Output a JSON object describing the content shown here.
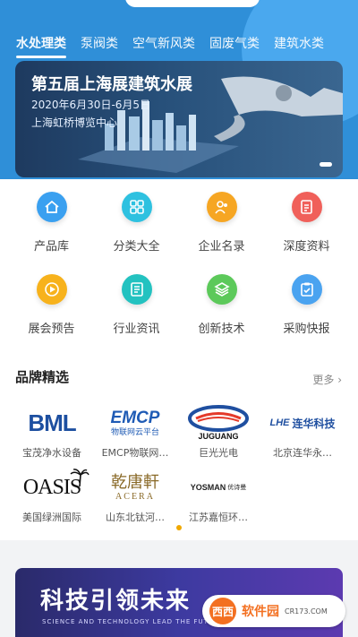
{
  "tabs": [
    "水处理类",
    "泵阀类",
    "空气新风类",
    "固废气类",
    "建筑水类"
  ],
  "active_tab": 0,
  "banner": {
    "title": "第五届上海展建筑水展",
    "date": "2020年6月30日-6月5日",
    "venue": "上海虹桥博览中心"
  },
  "grid": [
    {
      "label": "产品库",
      "icon": "home-icon",
      "color": "#3aa0f0"
    },
    {
      "label": "分类大全",
      "icon": "category-icon",
      "color": "#2ec1e0"
    },
    {
      "label": "企业名录",
      "icon": "people-icon",
      "color": "#f6a623"
    },
    {
      "label": "深度资料",
      "icon": "document-icon",
      "color": "#f0605a"
    },
    {
      "label": "展会预告",
      "icon": "play-icon",
      "color": "#f7b21c"
    },
    {
      "label": "行业资讯",
      "icon": "news-icon",
      "color": "#23c2c0"
    },
    {
      "label": "创新技术",
      "icon": "layers-icon",
      "color": "#5cc95a"
    },
    {
      "label": "采购快报",
      "icon": "clipboard-icon",
      "color": "#4aa3f0"
    }
  ],
  "brands": {
    "title": "品牌精选",
    "more": "更多 ›",
    "items": [
      {
        "name": "宝茂净水设备",
        "logo": "BML"
      },
      {
        "name": "EMCP物联网…",
        "logo": "EMCP",
        "logo_sub": "物联网云平台"
      },
      {
        "name": "巨光光电",
        "logo": "JUGUANG"
      },
      {
        "name": "北京连华永…",
        "logo": "连华科技",
        "logo_mark": "LHE"
      },
      {
        "name": "美国绿洲国际",
        "logo": "OASIS"
      },
      {
        "name": "山东北钛河…",
        "logo": "乾唐軒",
        "logo_sub": "ACERA"
      },
      {
        "name": "江苏嘉恒环…",
        "logo": "YOSMAN",
        "logo_sub": "优诗曼"
      }
    ]
  },
  "banner2": {
    "title": "科技引领未来",
    "subtitle": "SCIENCE AND TECHNOLOGY LEAD THE FUTURE"
  },
  "watermark": {
    "badge": "西西",
    "title": "软件园",
    "url": "CR173.COM"
  }
}
